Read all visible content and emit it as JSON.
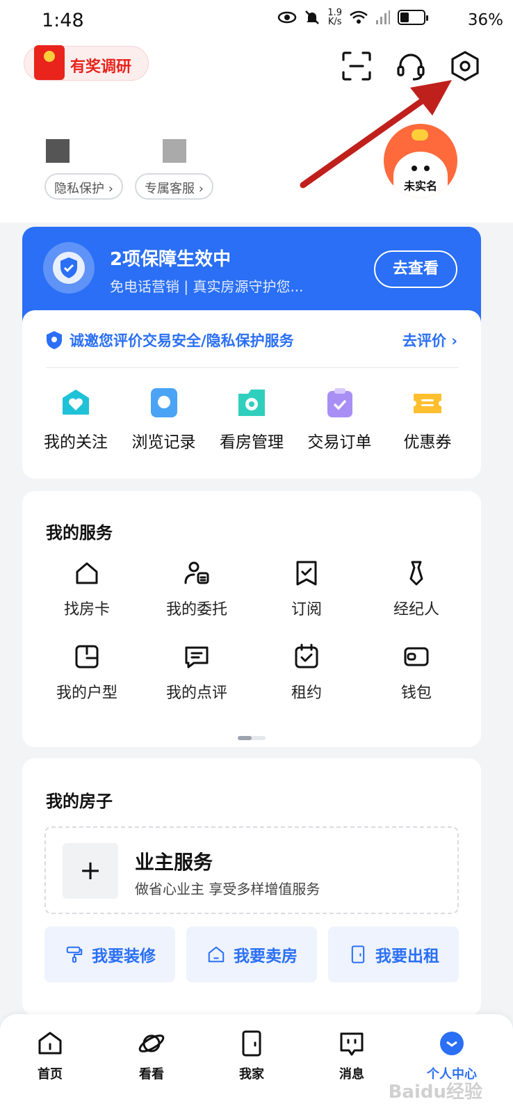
{
  "status_bar": {
    "time": "1:48",
    "net_speed_top": "1.9",
    "net_speed_bottom": "K/s",
    "battery_percent": "36%",
    "battery_level": 0.36
  },
  "header": {
    "survey_label": "有奖调研",
    "avatar_label": "未实名",
    "privacy_pill": "隐私保护 ›",
    "service_pill": "专属客服 ›"
  },
  "guarantee": {
    "title": "2项保障生效中",
    "subtitle": "免电话营销 | 真实房源守护您...",
    "button": "去查看"
  },
  "invite": {
    "text": "诚邀您评价交易安全/隐私保护服务",
    "action": "去评价 ›"
  },
  "quick_links": [
    {
      "label": "我的关注",
      "icon": "heart-icon",
      "color": "#1fc2d6"
    },
    {
      "label": "浏览记录",
      "icon": "search-bubble-icon",
      "color": "#4aa3f5"
    },
    {
      "label": "看房管理",
      "icon": "camera-icon",
      "color": "#2fcfbd"
    },
    {
      "label": "交易订单",
      "icon": "clipboard-check-icon",
      "color": "#a98ef5"
    },
    {
      "label": "优惠券",
      "icon": "coupon-icon",
      "color": "#ffbf2e"
    }
  ],
  "services": {
    "title": "我的服务",
    "items": [
      {
        "label": "找房卡",
        "icon": "house-icon"
      },
      {
        "label": "我的委托",
        "icon": "person-card-icon"
      },
      {
        "label": "订阅",
        "icon": "bookmark-check-icon"
      },
      {
        "label": "经纪人",
        "icon": "tie-icon"
      },
      {
        "label": "我的户型",
        "icon": "floorplan-icon"
      },
      {
        "label": "我的点评",
        "icon": "comment-icon"
      },
      {
        "label": "租约",
        "icon": "calendar-check-icon"
      },
      {
        "label": "钱包",
        "icon": "wallet-icon"
      }
    ]
  },
  "house": {
    "title": "我的房子",
    "owner_title": "业主服务",
    "owner_subtitle": "做省心业主 享受多样增值服务",
    "plus": "+",
    "actions": [
      {
        "label": "我要装修",
        "icon": "paint-roller-icon"
      },
      {
        "label": "我要卖房",
        "icon": "house-outline-icon"
      },
      {
        "label": "我要出租",
        "icon": "door-icon"
      }
    ]
  },
  "bottom_nav": [
    {
      "label": "首页",
      "icon": "home-icon",
      "active": false
    },
    {
      "label": "看看",
      "icon": "planet-icon",
      "active": false
    },
    {
      "label": "我家",
      "icon": "door-icon",
      "active": false
    },
    {
      "label": "消息",
      "icon": "message-icon",
      "active": false
    },
    {
      "label": "个人中心",
      "icon": "profile-icon",
      "active": true
    }
  ],
  "watermark": "Baidu经验",
  "colors": {
    "accent": "#2a6ff5",
    "annotation_arrow": "#c0201c",
    "survey_red": "#e8241c"
  }
}
